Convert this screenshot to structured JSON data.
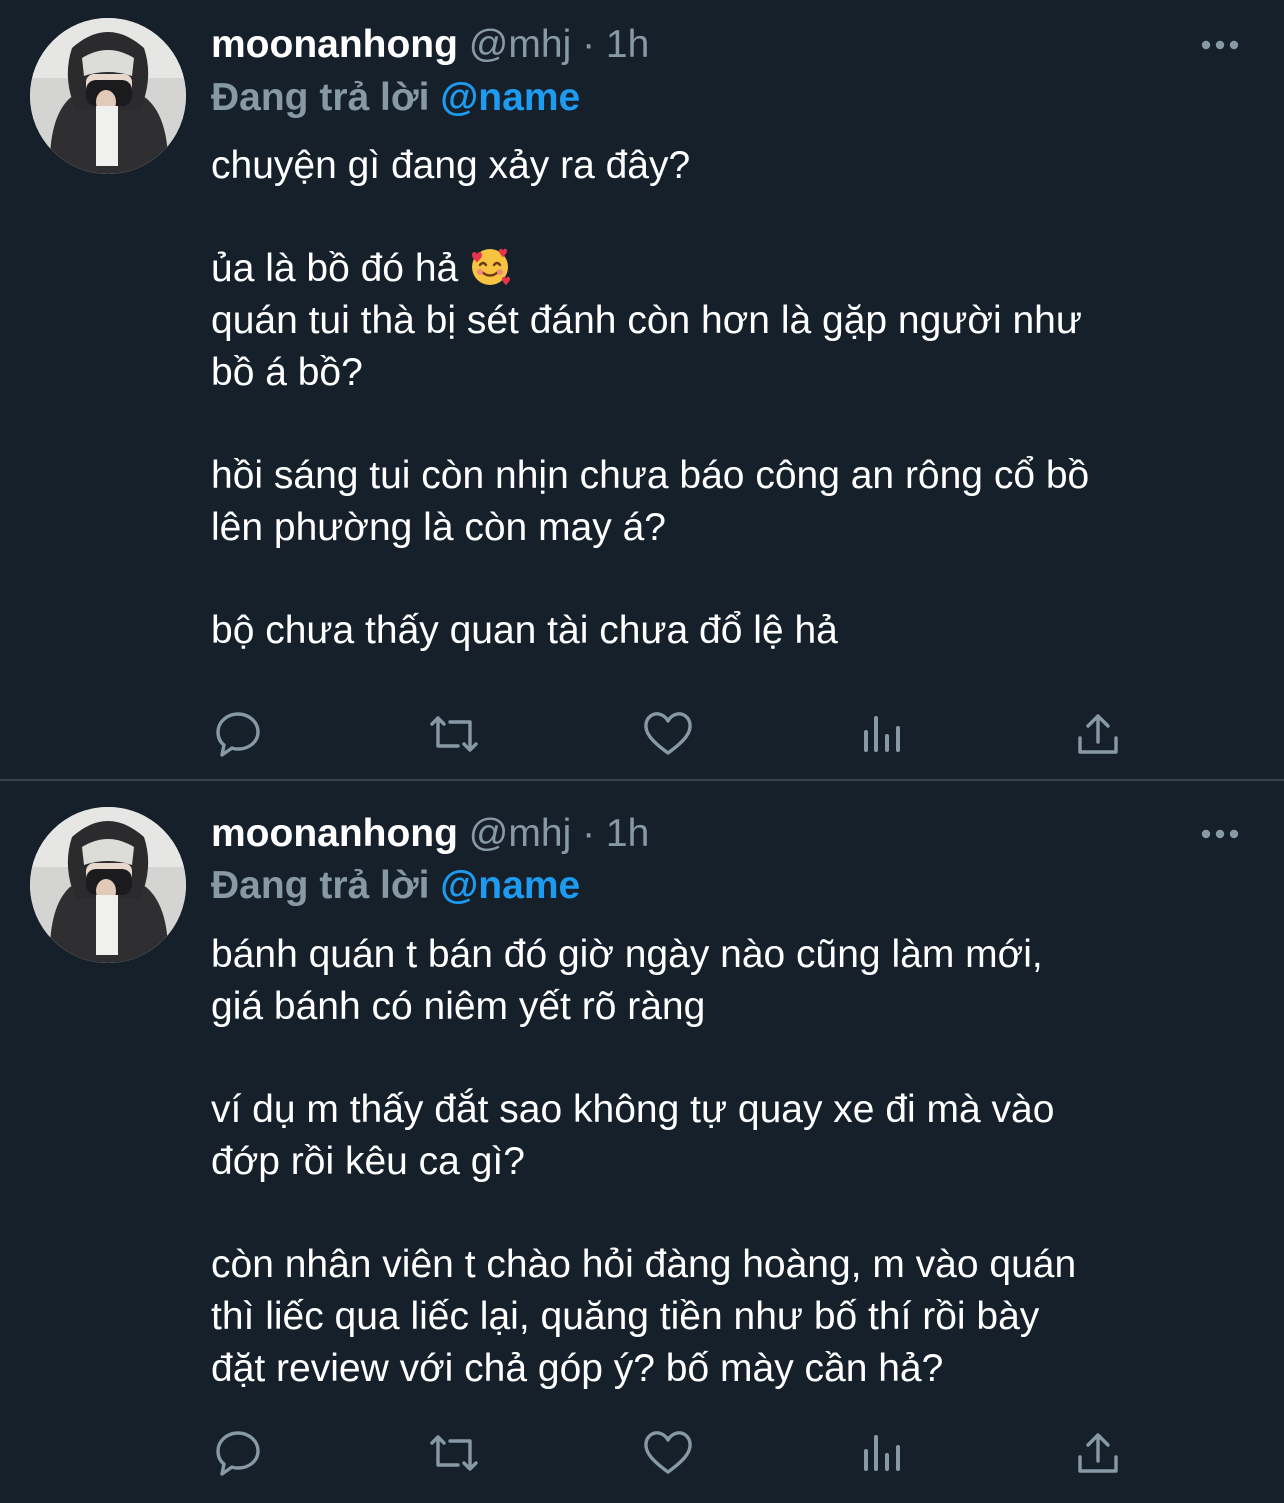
{
  "tweets": [
    {
      "display_name": "moonanhong",
      "handle": "@mhj",
      "separator": "·",
      "time": "1h",
      "reply_label": "Đang trả lời",
      "reply_to": "@name",
      "paragraphs": [
        [
          "chuyện gì đang xảy ra đây?"
        ],
        [
          "ủa là bồ đó hả",
          "quán tui thà bị sét đánh còn hơn là gặp người như",
          "bồ á bồ?"
        ],
        [
          "hồi sáng tui còn nhịn chưa báo công an rông cổ bồ",
          "lên phường là còn may á?"
        ],
        [
          "bộ chưa thấy quan tài chưa đổ lệ hả"
        ]
      ],
      "emoji": "smiling-face-with-hearts"
    },
    {
      "display_name": "moonanhong",
      "handle": "@mhj",
      "separator": "·",
      "time": "1h",
      "reply_label": "Đang trả lời",
      "reply_to": "@name",
      "paragraphs": [
        [
          "bánh quán t bán đó giờ ngày nào cũng làm mới,",
          "giá bánh có niêm yết rõ ràng"
        ],
        [
          "ví dụ m thấy đắt sao không tự quay xe đi mà vào",
          "đớp rồi kêu ca gì?"
        ],
        [
          "còn nhân viên t chào hỏi đàng hoàng, m vào quán",
          "thì liếc qua liếc lại, quăng tiền như bố thí rồi bày",
          "đặt review với chả góp ý? bố mày cần hả?"
        ]
      ]
    }
  ],
  "actions": [
    "reply-icon",
    "retweet-icon",
    "like-icon",
    "analytics-icon",
    "share-icon"
  ],
  "colors": {
    "background": "#15202b",
    "text": "#ffffff",
    "secondary": "#8899a6",
    "mention": "#1d9bf0",
    "divider": "#38444d"
  }
}
